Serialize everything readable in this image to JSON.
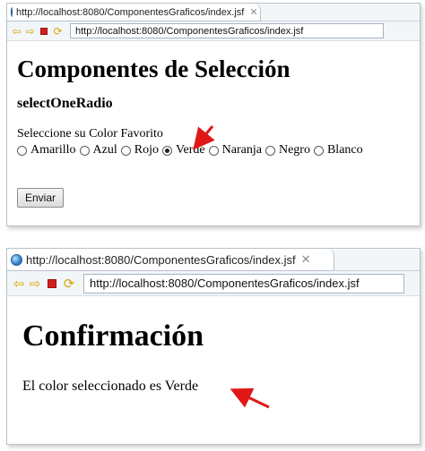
{
  "window1": {
    "tab_title": "http://localhost:8080/ComponentesGraficos/index.jsf",
    "url": "http://localhost:8080/ComponentesGraficos/index.jsf",
    "heading": "Componentes de Selección",
    "subheading": "selectOneRadio",
    "prompt": "Seleccione su Color Favorito",
    "options": [
      "Amarillo",
      "Azul",
      "Rojo",
      "Verde",
      "Naranja",
      "Negro",
      "Blanco"
    ],
    "selected": "Verde",
    "submit_label": "Enviar"
  },
  "window2": {
    "tab_title": "http://localhost:8080/ComponentesGraficos/index.jsf",
    "url": "http://localhost:8080/ComponentesGraficos/index.jsf",
    "heading": "Confirmación",
    "result_text": "El color seleccionado es Verde"
  },
  "icons": {
    "tab": "globe-icon",
    "close": "close-icon",
    "back": "back-arrow-icon",
    "forward": "forward-arrow-icon",
    "stop": "stop-icon",
    "refresh": "refresh-icon"
  },
  "colors": {
    "annotation_arrow": "#e01818",
    "stop": "#d21f1f",
    "nav_arrow": "#d9a400"
  }
}
